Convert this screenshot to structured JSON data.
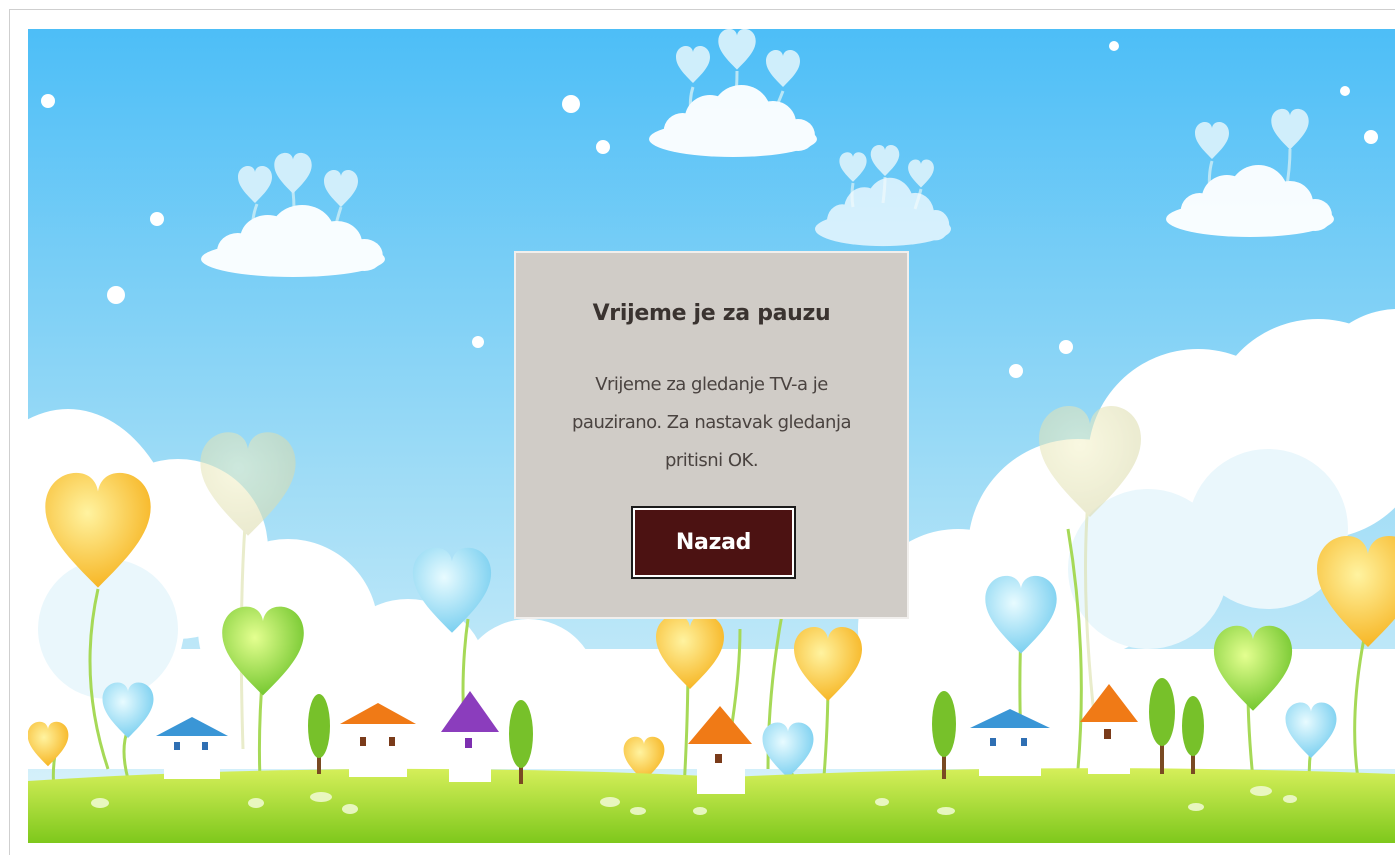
{
  "dialog": {
    "title": "Vrijeme je za pauzu",
    "message": "Vrijeme za gledanje TV-a je pauzirano. Za nastavak gledanja pritisni OK.",
    "back_label": "Nazad"
  },
  "colors": {
    "dialog_background": "#d0ccc7",
    "button_background": "#4c1212",
    "sky_top": "#4fc0f5",
    "grass": "#9ed82b"
  }
}
